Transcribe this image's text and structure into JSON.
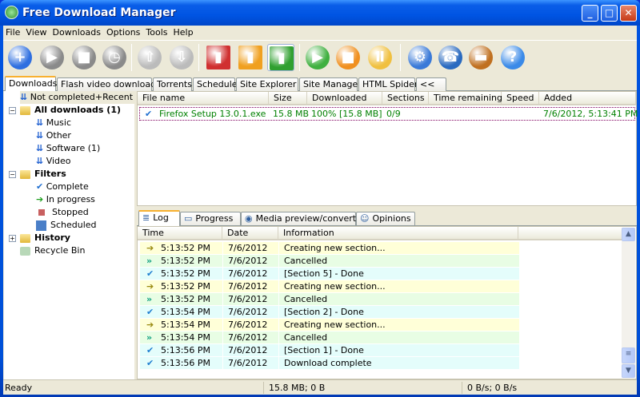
{
  "window": {
    "title": "Free Download Manager",
    "controls": [
      "minimize",
      "maximize",
      "close"
    ]
  },
  "menu": [
    "File",
    "View",
    "Downloads",
    "Options",
    "Tools",
    "Help"
  ],
  "toolbar": [
    {
      "icon": "add-icon",
      "color": "#2f6fe0"
    },
    {
      "icon": "start-icon",
      "color": "#8a8a8a"
    },
    {
      "icon": "stop-icon",
      "color": "#8a8a8a"
    },
    {
      "icon": "schedule-clock-icon",
      "color": "#8a8a8a"
    },
    {
      "icon": "move-up-icon",
      "color": "#bbbbbb"
    },
    {
      "icon": "move-down-icon",
      "color": "#bbbbbb"
    },
    {
      "icon": "speed-low-icon",
      "color": "#d03030"
    },
    {
      "icon": "speed-medium-icon",
      "color": "#f0a020"
    },
    {
      "icon": "speed-high-icon",
      "color": "#30a030"
    },
    {
      "icon": "start-all-icon",
      "color": "#40b040"
    },
    {
      "icon": "stop-all-icon",
      "color": "#f09020"
    },
    {
      "icon": "pause-all-icon",
      "color": "#f0c040"
    },
    {
      "icon": "settings-gear-icon",
      "color": "#3a7ad8"
    },
    {
      "icon": "dialup-globe-icon",
      "color": "#2a6ac0"
    },
    {
      "icon": "book-icon",
      "color": "#c07020"
    },
    {
      "icon": "help-icon",
      "color": "#3a8ae8"
    }
  ],
  "tabs": [
    "Downloads",
    "Flash video downloads",
    "Torrents",
    "Scheduler",
    "Site Explorer",
    "Site Manager",
    "HTML Spider",
    "<<"
  ],
  "tree": {
    "recent": "Not completed+Recent",
    "all": "All downloads (1)",
    "categories": [
      "Music",
      "Other",
      "Software (1)",
      "Video"
    ],
    "filters": "Filters",
    "filter_items": [
      "Complete",
      "In progress",
      "Stopped",
      "Scheduled"
    ],
    "history": "History",
    "recycle": "Recycle Bin"
  },
  "downloads": {
    "columns": [
      "File name",
      "Size",
      "Downloaded",
      "Sections",
      "Time remaining",
      "Speed",
      "Added"
    ],
    "rows": [
      {
        "file": "Firefox Setup 13.0.1.exe",
        "size": "15.8 MB",
        "downloaded": "100% [15.8 MB]",
        "sections": "0/9",
        "remaining": "",
        "speed": "",
        "added": "7/6/2012, 5:13:41 PM",
        "status": "complete"
      }
    ]
  },
  "bottom_tabs": [
    "Log",
    "Progress",
    "Media preview/convert",
    "Opinions"
  ],
  "log": {
    "columns": [
      "Time",
      "Date",
      "Information"
    ],
    "rows": [
      {
        "type": "info",
        "time": "5:13:52 PM",
        "date": "7/6/2012",
        "info": "Creating new section..."
      },
      {
        "type": "cancel",
        "time": "5:13:52 PM",
        "date": "7/6/2012",
        "info": "Cancelled"
      },
      {
        "type": "done",
        "time": "5:13:52 PM",
        "date": "7/6/2012",
        "info": "[Section 5] - Done"
      },
      {
        "type": "info",
        "time": "5:13:52 PM",
        "date": "7/6/2012",
        "info": "Creating new section..."
      },
      {
        "type": "cancel",
        "time": "5:13:52 PM",
        "date": "7/6/2012",
        "info": "Cancelled"
      },
      {
        "type": "done",
        "time": "5:13:54 PM",
        "date": "7/6/2012",
        "info": "[Section 2] - Done"
      },
      {
        "type": "info",
        "time": "5:13:54 PM",
        "date": "7/6/2012",
        "info": "Creating new section..."
      },
      {
        "type": "cancel",
        "time": "5:13:54 PM",
        "date": "7/6/2012",
        "info": "Cancelled"
      },
      {
        "type": "done",
        "time": "5:13:56 PM",
        "date": "7/6/2012",
        "info": "[Section 1] - Done"
      },
      {
        "type": "done",
        "time": "5:13:56 PM",
        "date": "7/6/2012",
        "info": "Download complete"
      }
    ],
    "row_colors": {
      "info": "#ffffd8",
      "cancel": "#e8fde4",
      "done": "#e4fdfb"
    }
  },
  "status": {
    "state": "Ready",
    "size": "15.8 MB; 0 B",
    "speed": "0 B/s; 0 B/s"
  }
}
